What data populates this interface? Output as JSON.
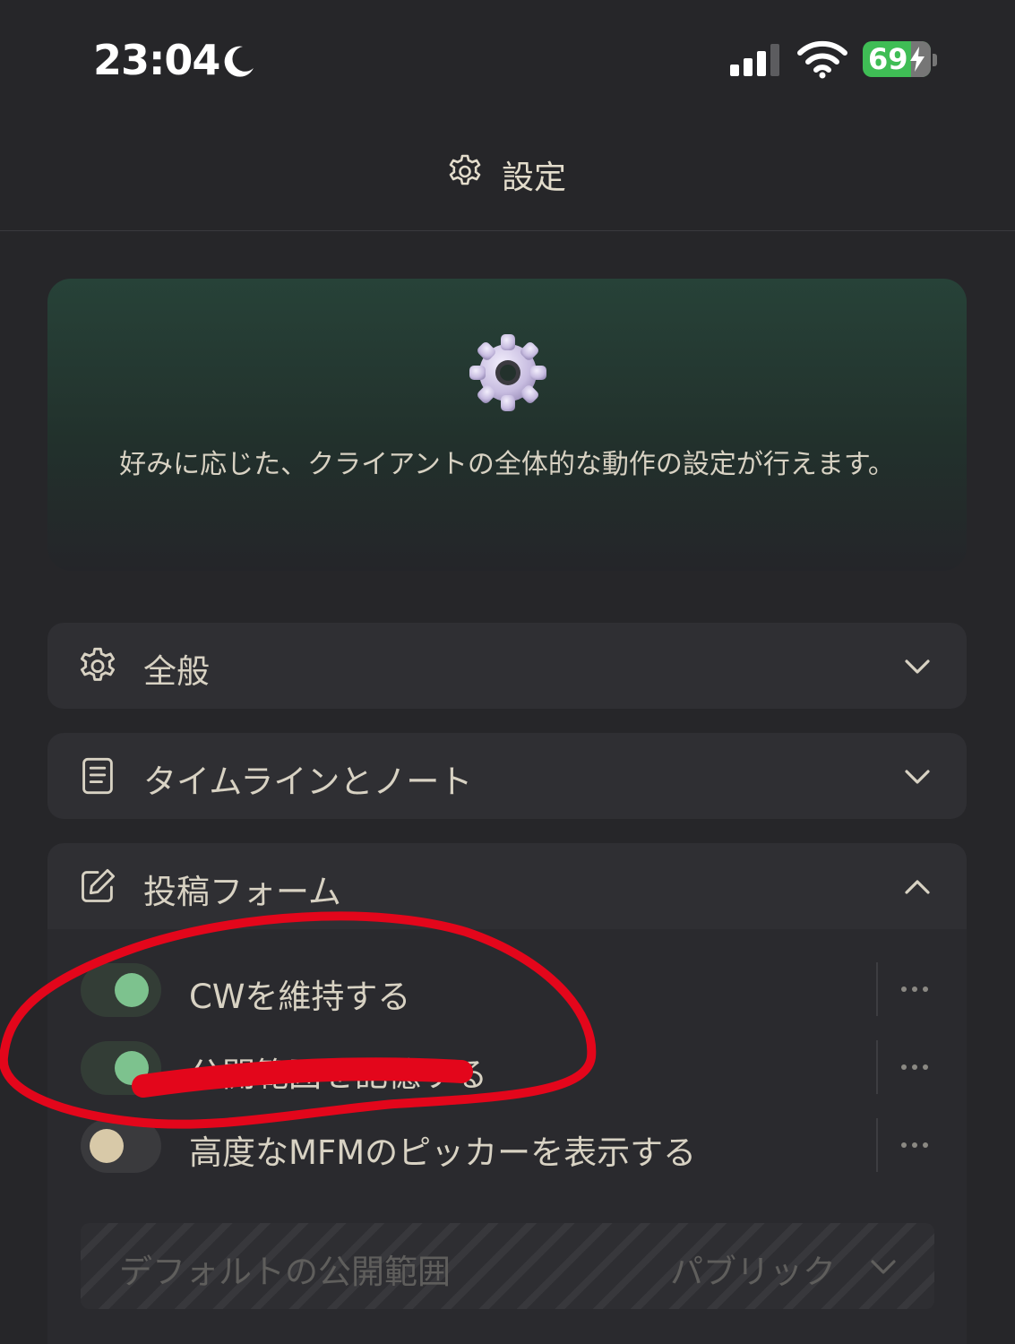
{
  "status_bar": {
    "time": "23:04",
    "battery_percent": "69",
    "icons": [
      "moon-icon",
      "cellular-signal-icon",
      "wifi-icon",
      "battery-charging-icon"
    ]
  },
  "header": {
    "title": "設定",
    "icon": "gear-icon"
  },
  "banner": {
    "icon": "gear-emoji",
    "description": "好みに応じた、クライアントの全体的な動作の設定が行えます。"
  },
  "sections": {
    "general": {
      "label": "全般",
      "icon": "gear-icon",
      "expanded": false
    },
    "timeline": {
      "label": "タイムラインとノート",
      "icon": "document-icon",
      "expanded": false
    },
    "post_form": {
      "label": "投稿フォーム",
      "icon": "edit-icon",
      "expanded": true
    }
  },
  "post_form": {
    "toggles": [
      {
        "label": "CWを維持する",
        "enabled": true
      },
      {
        "label": "公開範囲を記憶する",
        "enabled": true
      },
      {
        "label": "高度なMFMのピッカーを表示する",
        "enabled": false
      }
    ],
    "default_visibility": {
      "label": "デフォルトの公開範囲",
      "value": "パブリック",
      "disabled": true
    }
  },
  "colors": {
    "background": "#262629",
    "card": "#2f2f33",
    "banner_top": "#274238",
    "toggle_on": "#7dc28e",
    "toggle_off_knob": "#d8c9a8",
    "text": "#d8d2c3",
    "annotation": "#e3061b"
  }
}
